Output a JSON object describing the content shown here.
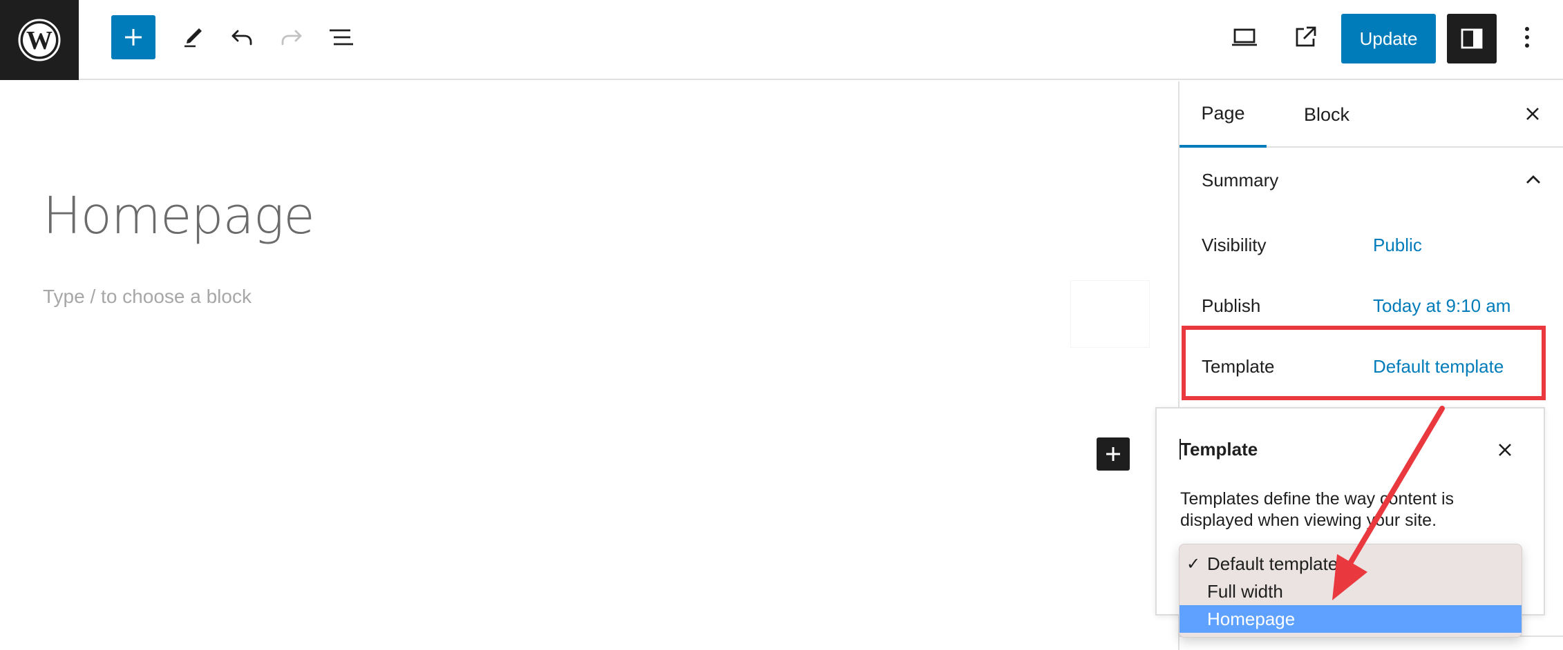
{
  "toolbar": {
    "update_label": "Update"
  },
  "editor": {
    "page_title": "Homepage",
    "block_placeholder": "Type / to choose a block"
  },
  "sidebar": {
    "tabs": [
      {
        "label": "Page",
        "active": true
      },
      {
        "label": "Block",
        "active": false
      }
    ],
    "summary_title": "Summary",
    "rows": [
      {
        "label": "Visibility",
        "value": "Public"
      },
      {
        "label": "Publish",
        "value": "Today at 9:10 am"
      },
      {
        "label": "Template",
        "value": "Default template"
      }
    ]
  },
  "template_popover": {
    "title": "Template",
    "description": "Templates define the way content is displayed when viewing your site."
  },
  "template_dropdown": {
    "options": [
      {
        "label": "Default template",
        "checked": true,
        "highlighted": false
      },
      {
        "label": "Full width",
        "checked": false,
        "highlighted": false
      },
      {
        "label": "Homepage",
        "checked": false,
        "highlighted": true
      }
    ],
    "check_glyph": "✓"
  },
  "annotation": {
    "highlight_color": "#e9393f",
    "arrow_color": "#e9393f"
  },
  "colors": {
    "accent": "#007cba",
    "dark": "#1e1e1e",
    "selection": "#5ea1ff"
  },
  "icons": [
    "wordpress-logo-icon",
    "plus-icon",
    "pencil-icon",
    "undo-icon",
    "redo-icon",
    "list-view-icon",
    "desktop-preview-icon",
    "external-link-icon",
    "sidebar-toggle-icon",
    "more-vertical-icon",
    "close-icon",
    "chevron-up-icon"
  ]
}
